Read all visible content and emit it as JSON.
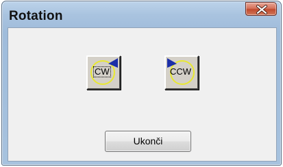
{
  "window": {
    "title": "Rotation",
    "close_icon": "close-x-icon"
  },
  "buttons": {
    "cw_label": "CW",
    "cw_icon": "rotate-clockwise-icon",
    "ccw_label": "CCW",
    "ccw_icon": "rotate-counterclockwise-icon",
    "end_label": "Ukonči"
  },
  "colors": {
    "circle": "#e8e830",
    "arrow": "#1c2fa8",
    "close": "#c9573e"
  }
}
